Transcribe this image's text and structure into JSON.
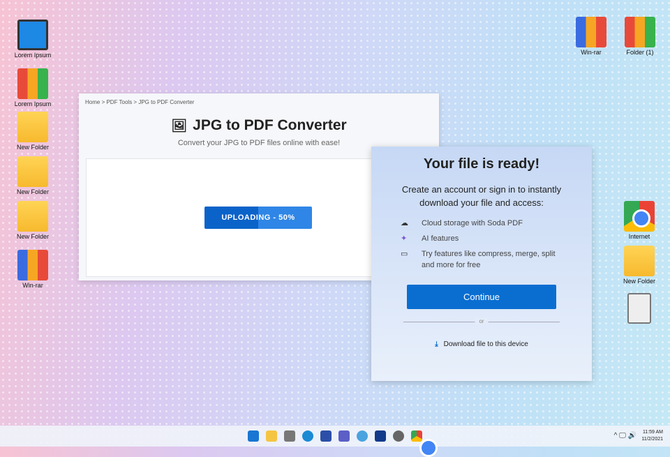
{
  "desktop_icons": [
    {
      "label": "Lorem Ipsum",
      "icon": "computer-icon"
    },
    {
      "label": "Lorem Ipsum",
      "icon": "binders-icon"
    },
    {
      "label": "New Folder",
      "icon": "folder-icon"
    },
    {
      "label": "New Folder",
      "icon": "folder-icon"
    },
    {
      "label": "New Folder",
      "icon": "folder-icon"
    },
    {
      "label": "Win-rar",
      "icon": "winrar-icon"
    },
    {
      "label": "Win-rar",
      "icon": "winrar-icon"
    },
    {
      "label": "Folder (1)",
      "icon": "binders-icon"
    },
    {
      "label": "Internet",
      "icon": "chrome-icon"
    },
    {
      "label": "New Folder",
      "icon": "folder-icon"
    },
    {
      "label": "",
      "icon": "recycle-bin-icon"
    }
  ],
  "converter": {
    "breadcrumb": "Home > PDF Tools > JPG to PDF Converter",
    "title": "JPG to PDF Converter",
    "subtitle": "Convert your JPG to PDF files online with ease!",
    "upload_label": "UPLOADING - 50%",
    "progress_percent": 50
  },
  "dialog": {
    "title": "Your file is ready!",
    "description": "Create an account or sign in to instantly download your file and access:",
    "features": [
      "Cloud storage with Soda PDF",
      "AI features",
      "Try features like compress, merge, split and more for free"
    ],
    "continue": "Continue",
    "or": "or",
    "download": "Download file to this device"
  },
  "taskbar": {
    "time": "11:59 AM",
    "date": "11/2/2021"
  }
}
